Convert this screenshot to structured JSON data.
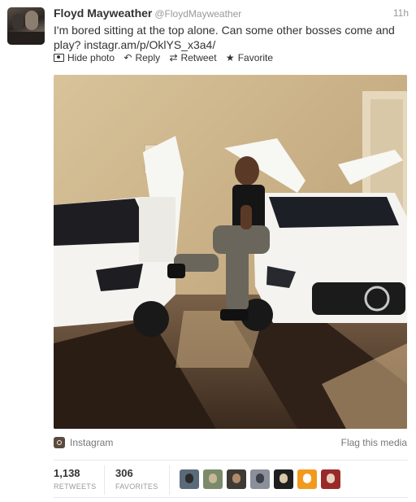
{
  "tweet": {
    "name": "Floyd Mayweather",
    "handle": "@FloydMayweather",
    "time": "11h",
    "text": "I'm bored sitting at the top alone. Can some other bosses come and play? instagr.am/p/OklYS_x3a4/"
  },
  "actions": {
    "hide_photo": "Hide photo",
    "reply": "Reply",
    "retweet": "Retweet",
    "favorite": "Favorite"
  },
  "media": {
    "source": "Instagram",
    "flag": "Flag this media"
  },
  "stats": {
    "retweets_count": "1,138",
    "retweets_label": "RETWEETS",
    "favorites_count": "306",
    "favorites_label": "FAVORITES"
  },
  "icons": {
    "photo": "photo-icon",
    "reply": "reply-icon",
    "retweet": "retweet-icon",
    "favorite": "star-icon",
    "instagram": "instagram-icon"
  },
  "favoriter_avatars": [
    {
      "bg": "#5a6a7a",
      "fg": "#2b2b2b"
    },
    {
      "bg": "#7a8a6a",
      "fg": "#c7b89a"
    },
    {
      "bg": "#3e3a36",
      "fg": "#b08a6a"
    },
    {
      "bg": "#8a8f9a",
      "fg": "#3c4048"
    },
    {
      "bg": "#1f1f1f",
      "fg": "#d8c9a8"
    },
    {
      "bg": "#f29a1c",
      "fg": "#ffffff"
    },
    {
      "bg": "#9a2a2a",
      "fg": "#e8d0c0"
    }
  ],
  "colors": {
    "text": "#333333",
    "muted": "#999999",
    "divider": "#e8e8e8"
  }
}
